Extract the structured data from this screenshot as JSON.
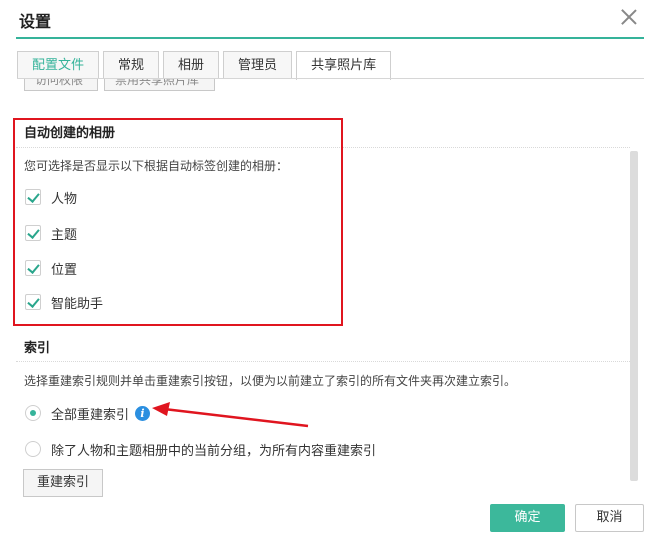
{
  "dialog": {
    "title": "设置"
  },
  "tabs": [
    {
      "label": "配置文件"
    },
    {
      "label": "常规"
    },
    {
      "label": "相册"
    },
    {
      "label": "管理员"
    },
    {
      "label": "共享照片库"
    }
  ],
  "top_buttons": [
    {
      "label": "访问权限"
    },
    {
      "label": "禁用共享照片库"
    }
  ],
  "auto_albums": {
    "title": "自动创建的相册",
    "description": "您可选择是否显示以下根据自动标签创建的相册：",
    "items": [
      {
        "label": "人物",
        "checked": true
      },
      {
        "label": "主题",
        "checked": true
      },
      {
        "label": "位置",
        "checked": true
      },
      {
        "label": "智能助手",
        "checked": true
      }
    ]
  },
  "index": {
    "title": "索引",
    "description": "选择重建索引规则并单击重建索引按钮，以便为以前建立了索引的所有文件夹再次建立索引。",
    "options": [
      {
        "label": "全部重建索引",
        "selected": true,
        "icon": "info-icon"
      },
      {
        "label": "除了人物和主题相册中的当前分组，为所有内容重建索引",
        "selected": false
      }
    ],
    "rebuild_label": "重建索引"
  },
  "footer": {
    "ok_label": "确定",
    "cancel_label": "取消"
  },
  "colors": {
    "accent": "#35b39a",
    "highlight": "#e0151f",
    "info": "#2b8fe0"
  }
}
